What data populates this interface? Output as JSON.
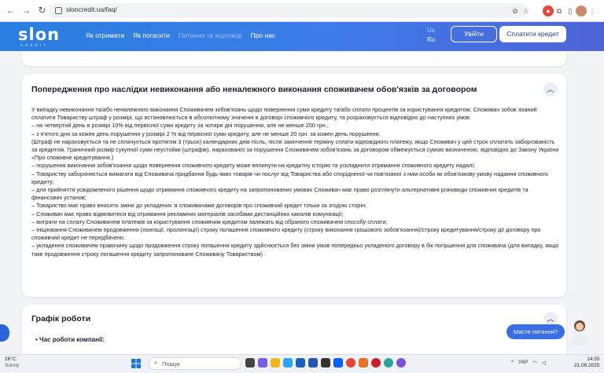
{
  "browser": {
    "url": "sloncredit.ua/faq/"
  },
  "header": {
    "logo": "slon",
    "logo_sub": "CREDIT",
    "menu": [
      {
        "label": "Як отримати"
      },
      {
        "label": "Як погасити"
      },
      {
        "label": "Питання та відповіді",
        "active": true
      },
      {
        "label": "Про нас"
      }
    ],
    "lang_ua": "Ua",
    "lang_ru": "Ru",
    "login_label": "Увійти",
    "pay_label": "Сплатити кредит"
  },
  "faq": {
    "title": "Попередження про наслідки невиконання або неналежного виконання споживачем обов'язків за договором",
    "paragraphs": [
      "У випадку невиконання та/або неналежного виконання Споживачем зобов'язань щодо повернення суми кредиту та/або сплати процентів за користування кредитом, Споживач зобов`язаний сплатити Товариству штраф у розмірі, що встановлюється в абсолютному значенні в договорі споживчого кредиту, та розраховується відповідно до наступних умов:",
      "– на четвертий день в розмірі 10% від первісної суми кредиту за чотири дні порушення, але не менше 200 грн.;",
      "– з п'ятого дня за кожен день порушення у розмірі 2 % від первісної суми кредиту, але не менше 20 грн. за кожен день порушення.",
      "(Штраф не нараховується та не сплачується протягом 3 (трьох) календарних днів післь, після закінчення терміну сплати відповідного платежу, якщо Споживач у цей строк сплатить заборгованість за кредитом. Граничний розмір сукупної суми неустойки (штрафів), нарахованої за порушення Споживачем зобов'язань за договором обмежується сумою визначеною, відповідно до Закону України «Про споживче кредитування.)",
      "– порушення виконання зобов'язання щодо повернення споживчого кредиту може вплинути на кредитну історію та ускладнити отримання споживчого кредиту надалі;",
      "– Товариству забороняється вимагати від Споживача придбання будь-яких товарів чи послуг від Товариства або спорідненої чи пов'язаної з ним особи як обов'язкову умову надання споживчого кредиту;",
      "– для прийняття усвідомленого рішення щодо отримання споживчого кредиту на запропонованих умовах Споживач має право розглянути альтернативні різновиди споживчих кредитів та фінансових установ;",
      "– Товариство має право вносити зміни до укладених зі споживачами договорів про споживчий кредит тільки за згодою сторін;",
      "– Споживач має право відмовитися від отримання рекламних матеріалів засобами дистанційних каналів комунікації;",
      "– витрати на сплату Споживачем платежів за користування споживчим кредитом залежать від обраного споживачем способу сплати;",
      "– Iніціювання Споживачем продовження (лонгації, пролонгації) строку погашення споживчого кредиту (строку виконання грошового зобов'язання)/строку кредитування/строку дії договору про споживчий кредит не передбачено.",
      "– укладення споживачем правочину щодо продовження строку погашення кредиту здійснюється без зміни умов попередньо укладеного договору в бік погіршення для споживача (для випадку, якщо таке продовження строку погашення кредиту запропоноване Споживачу Товариством) ."
    ]
  },
  "schedule": {
    "title": "Графік роботи",
    "bullet": "Час роботи компанії:"
  },
  "chat": {
    "label": "Масте питання?"
  },
  "taskbar": {
    "temp": "26°C",
    "weather": "Sunny",
    "search_placeholder": "Пошук",
    "lang": "УКР",
    "time": "14:55",
    "date": "21.09.2025"
  }
}
